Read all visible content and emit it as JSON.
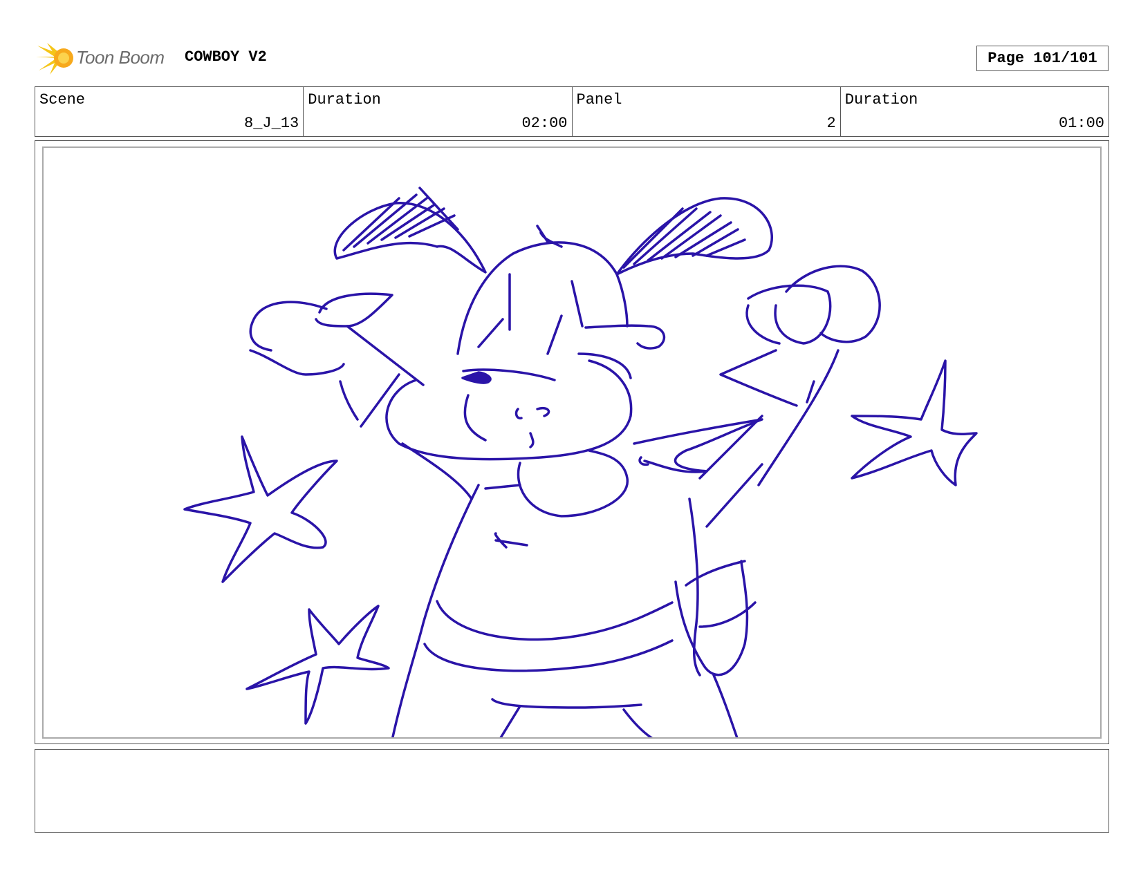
{
  "header": {
    "logo_text": "Toon Boom",
    "project_title": "COWBOY V2",
    "page_label": "Page 101/101"
  },
  "info": {
    "scene_label": "Scene",
    "scene_value": "8_J_13",
    "scene_duration_label": "Duration",
    "scene_duration_value": "02:00",
    "panel_label": "Panel",
    "panel_value": "2",
    "panel_duration_label": "Duration",
    "panel_duration_value": "01:00"
  },
  "colors": {
    "sketch_stroke": "#2a14a8",
    "logo_accent": "#f5c518"
  },
  "notes": {
    "text": ""
  }
}
